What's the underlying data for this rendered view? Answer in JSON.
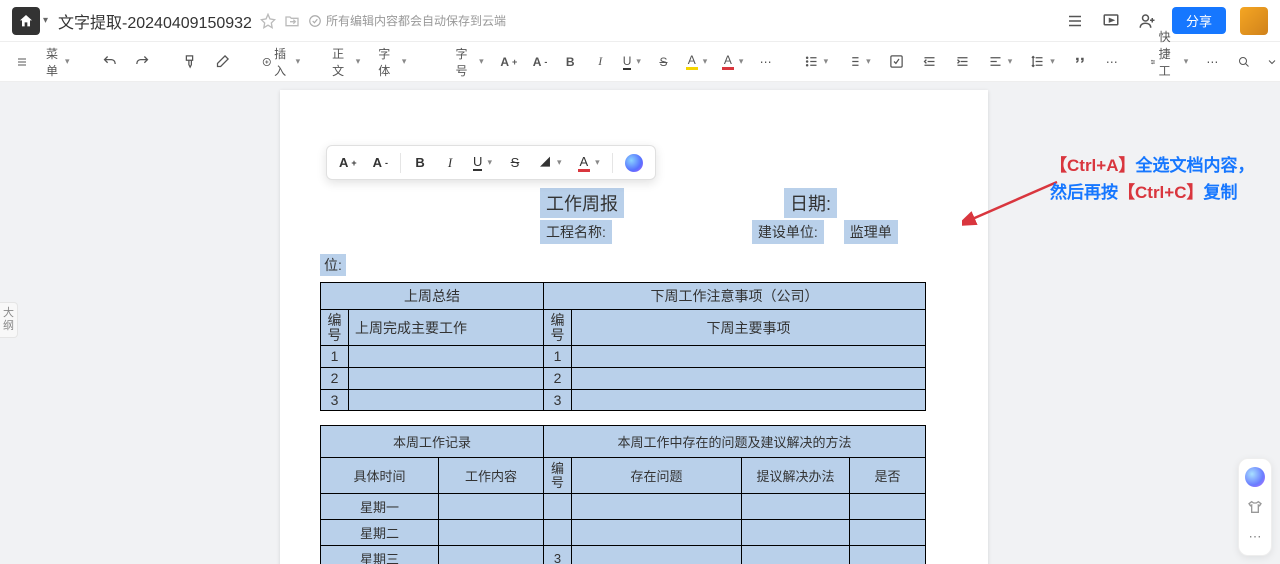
{
  "header": {
    "doc_title": "文字提取-20240409150932",
    "cloud_status": "所有编辑内容都会自动保存到云端",
    "share_label": "分享"
  },
  "toolbar": {
    "menu": "菜单",
    "insert": "插入",
    "style": "正文",
    "font": "字体",
    "font_size": "字号",
    "quick_tools": "快捷工具"
  },
  "outline_tab": "大纲",
  "float_toolbar": {
    "a_plus": "A⁺",
    "a_minus": "A⁻",
    "b": "B",
    "i": "I",
    "u": "U",
    "s": "S"
  },
  "doc": {
    "title": "工作周报",
    "date_label": "日期:",
    "project_label": "工程名称:",
    "build_label": "建设单位:",
    "supervisor_label": "监理单",
    "wei": "位:",
    "table1": {
      "left_header": "上周总结",
      "right_header": "下周工作注意事项（公司）",
      "num_label": "编号",
      "left_sub": "上周完成主要工作",
      "right_sub": "下周主要事项",
      "rows": [
        "1",
        "2",
        "3"
      ]
    },
    "table2": {
      "left_header": "本周工作记录",
      "right_header": "本周工作中存在的问题及建议解决的方法",
      "time_col": "具体时间",
      "content_col": "工作内容",
      "num_label": "编号",
      "problem_col": "存在问题",
      "suggest_col": "提议解决办法",
      "yesno_col": "是否",
      "days": [
        "星期一",
        "星期二",
        "星期三"
      ],
      "row3_num": "3"
    }
  },
  "annotation": {
    "line1a": "【Ctrl+A】",
    "line1b": "全选文档内容，然后再按",
    "line2a": "【Ctrl+C】",
    "line2b": "复制"
  }
}
